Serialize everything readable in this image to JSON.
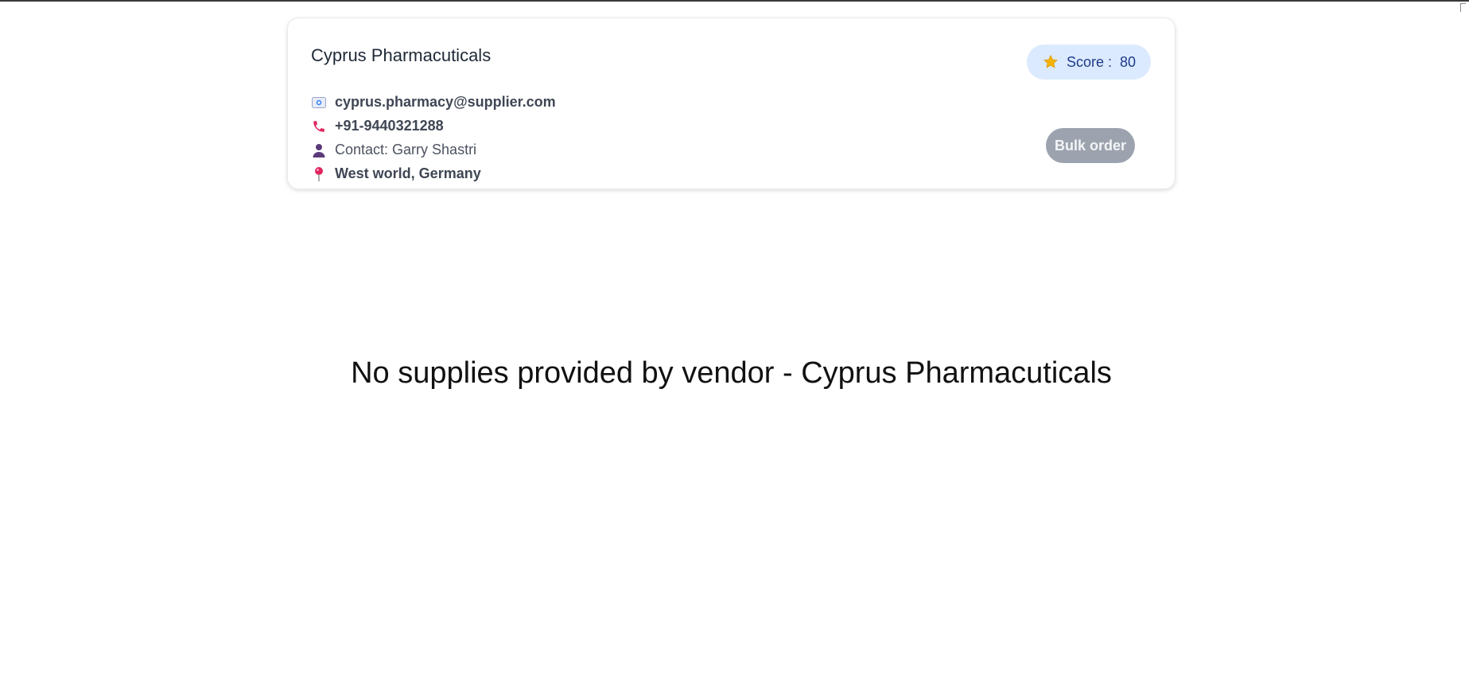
{
  "vendor": {
    "name": "Cyprus Pharmacuticals",
    "email": "cyprus.pharmacy@supplier.com",
    "phone": "+91-9440321288",
    "contact": "Contact: Garry Shastri",
    "location": "West world, Germany",
    "icons": {
      "email": "id-card-icon",
      "phone": "phone-icon",
      "contact": "person-icon",
      "location": "map-pin-icon"
    }
  },
  "score": {
    "label": "Score :",
    "value": "80",
    "icon": "star-icon"
  },
  "actions": {
    "bulk_order_label": "Bulk order"
  },
  "empty_state": {
    "message": "No supplies provided by vendor - Cyprus Pharmacuticals"
  },
  "colors": {
    "score_badge_bg": "#dbeafe",
    "score_text": "#1e3a8a",
    "button_disabled_bg": "#9ca3af",
    "phone_icon": "#e0245e",
    "pin_icon": "#e0245e",
    "person_icon": "#5b3a7a",
    "star_icon": "#f5b301"
  }
}
